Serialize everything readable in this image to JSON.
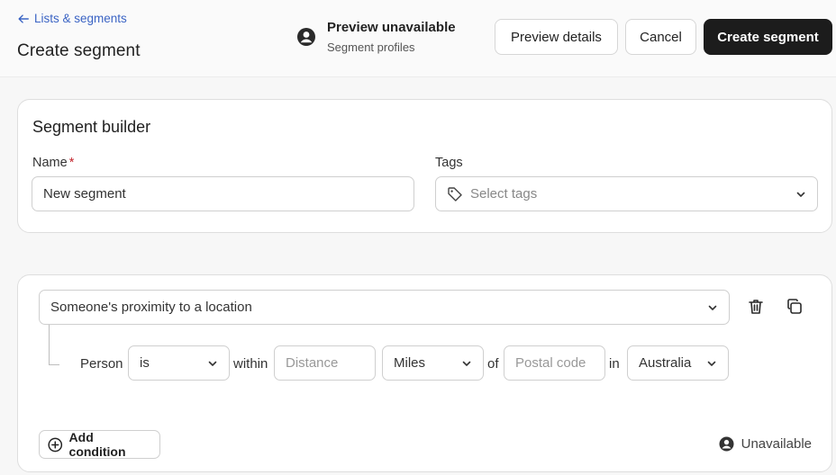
{
  "header": {
    "back_link": "Lists & segments",
    "title": "Create segment",
    "preview_title": "Preview unavailable",
    "preview_subtitle": "Segment profiles",
    "buttons": {
      "preview": "Preview details",
      "cancel": "Cancel",
      "create": "Create segment"
    }
  },
  "builder": {
    "title": "Segment builder",
    "name_label": "Name",
    "required_mark": "*",
    "name_value": "New segment",
    "tags_label": "Tags",
    "tags_placeholder": "Select tags"
  },
  "condition": {
    "type": "Someone's proximity to a location",
    "subject": "Person",
    "operator": "is",
    "within_word": "within",
    "distance_placeholder": "Distance",
    "unit": "Miles",
    "of_word": "of",
    "postal_placeholder": "Postal code",
    "in_word": "in",
    "country": "Australia"
  },
  "footer": {
    "add_condition": "Add condition",
    "status": "Unavailable"
  },
  "icons": {
    "back": "arrow-left-icon",
    "avatar": "user-circle-icon",
    "tag": "tag-icon",
    "chevron": "chevron-down-icon",
    "delete": "trash-icon",
    "duplicate": "copy-icon",
    "add": "plus-circle-icon"
  },
  "colors": {
    "link": "#3b64c4",
    "primary_button": "#1c1c1c",
    "required": "#c4262e"
  }
}
